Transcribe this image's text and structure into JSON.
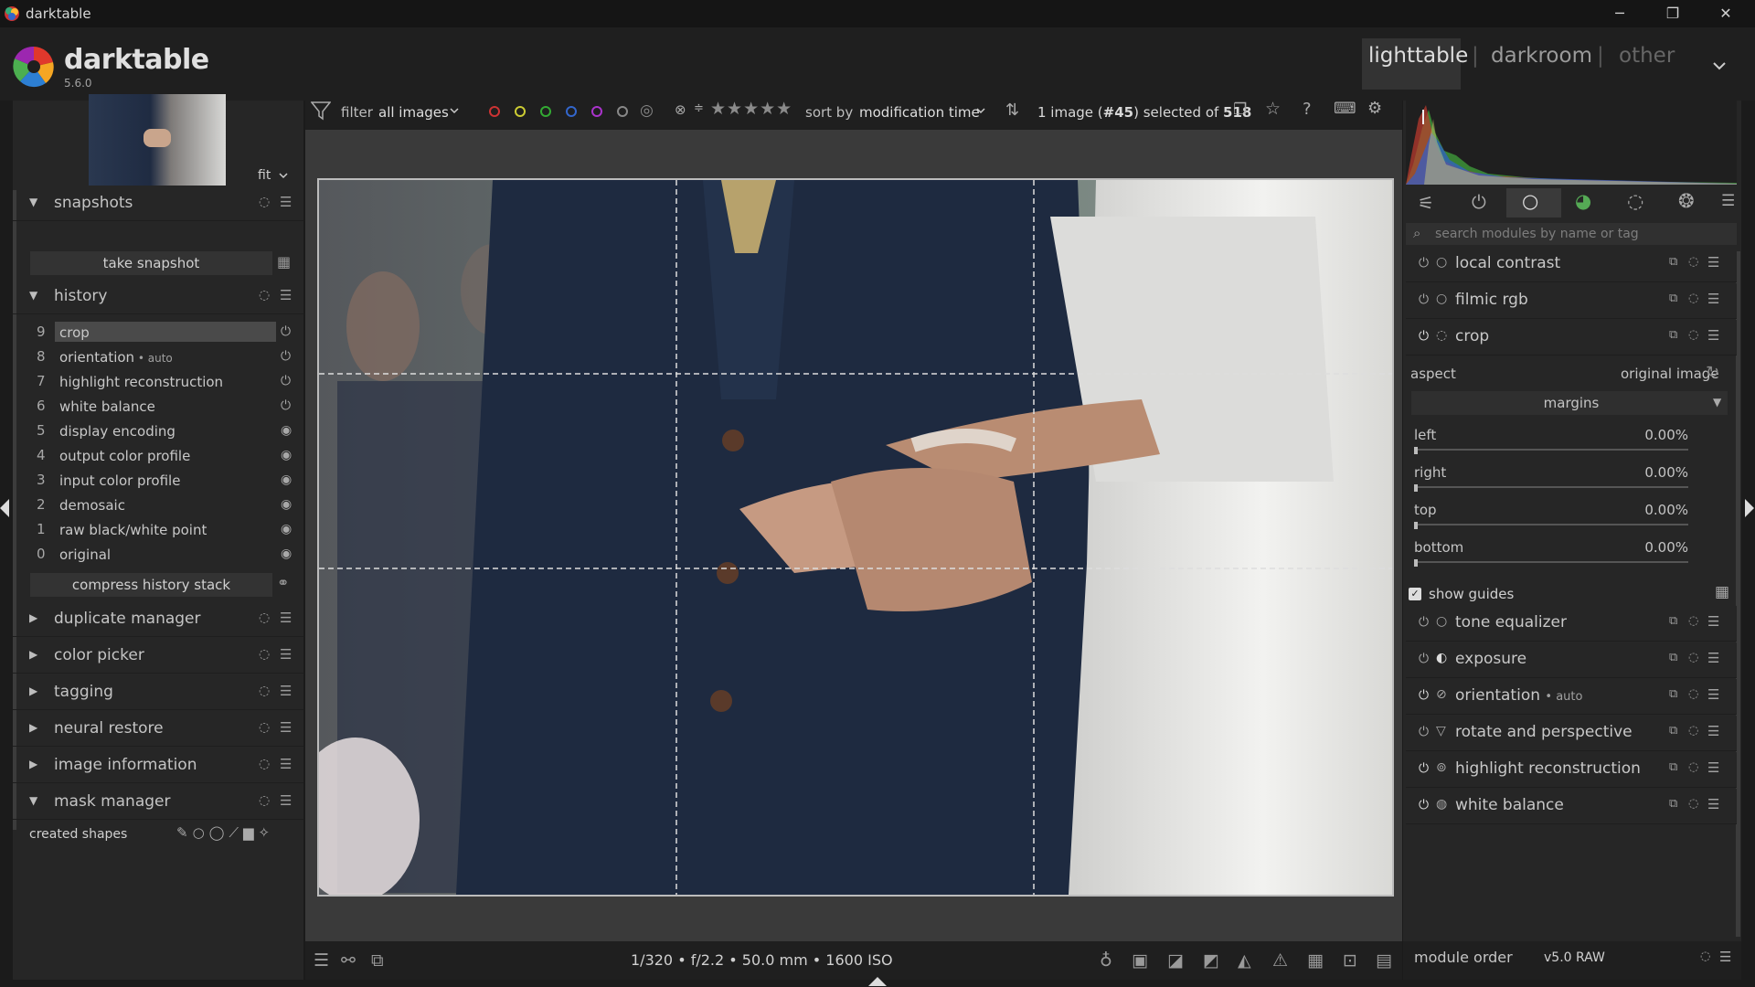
{
  "window": {
    "title": "darktable",
    "minimize_glyph": "─",
    "restore_glyph": "❐",
    "close_glyph": "✕"
  },
  "app": {
    "name": "darktable",
    "version": "5.6.0"
  },
  "views": {
    "lighttable": "lighttable",
    "darkroom": "darkroom",
    "other": "other",
    "separator": "|"
  },
  "thumb": {
    "zoom_label": "fit"
  },
  "topbar": {
    "filter_label": "filter",
    "filter_value": "all images",
    "sort_label": "sort by",
    "sort_value": "modification time",
    "selection_prefix": "1 image (",
    "selection_id": "#45",
    "selection_mid": ") selected of ",
    "selection_total": "518",
    "stars": "★★★★★"
  },
  "left": {
    "snapshots": {
      "label": "snapshots",
      "take_snapshot": "take snapshot"
    },
    "history": {
      "label": "history",
      "items": [
        {
          "num": "9",
          "name": "crop",
          "suffix": ""
        },
        {
          "num": "8",
          "name": "orientation",
          "suffix": " • auto"
        },
        {
          "num": "7",
          "name": "highlight reconstruction",
          "suffix": ""
        },
        {
          "num": "6",
          "name": "white balance",
          "suffix": ""
        },
        {
          "num": "5",
          "name": "display encoding",
          "suffix": ""
        },
        {
          "num": "4",
          "name": "output color profile",
          "suffix": ""
        },
        {
          "num": "3",
          "name": "input color profile",
          "suffix": ""
        },
        {
          "num": "2",
          "name": "demosaic",
          "suffix": ""
        },
        {
          "num": "1",
          "name": "raw black/white point",
          "suffix": ""
        },
        {
          "num": "0",
          "name": "original",
          "suffix": ""
        }
      ],
      "compress": "compress history stack"
    },
    "modules": {
      "duplicate_manager": "duplicate manager",
      "color_picker": "color picker",
      "tagging": "tagging",
      "neural_restore": "neural restore",
      "image_information": "image information",
      "mask_manager": "mask manager"
    },
    "created_shapes": "created shapes"
  },
  "right": {
    "search_placeholder": "search modules by name or tag",
    "modules_top": {
      "local_contrast": "local contrast",
      "filmic_rgb": "filmic rgb",
      "crop": "crop"
    },
    "crop": {
      "aspect_label": "aspect",
      "aspect_value": "original image",
      "margins": "margins",
      "left": {
        "label": "left",
        "value": "0.00%"
      },
      "right": {
        "label": "right",
        "value": "0.00%"
      },
      "top": {
        "label": "top",
        "value": "0.00%"
      },
      "bottom": {
        "label": "bottom",
        "value": "0.00%"
      },
      "show_guides": "show guides"
    },
    "modules_bottom": {
      "tone_equalizer": "tone equalizer",
      "exposure": "exposure",
      "orientation": "orientation",
      "orientation_suffix": "• auto",
      "rotate_perspective": "rotate and perspective",
      "highlight_reconstruction": "highlight reconstruction",
      "white_balance": "white balance"
    },
    "module_order_label": "module order",
    "module_order_value": "v5.0 RAW"
  },
  "bottom": {
    "exif": "1/320 • f/2.2 • 50.0 mm • 1600 ISO"
  },
  "colors": {
    "accent": "#cfcfcf",
    "panel": "#262626",
    "center": "#3a3a3a"
  }
}
